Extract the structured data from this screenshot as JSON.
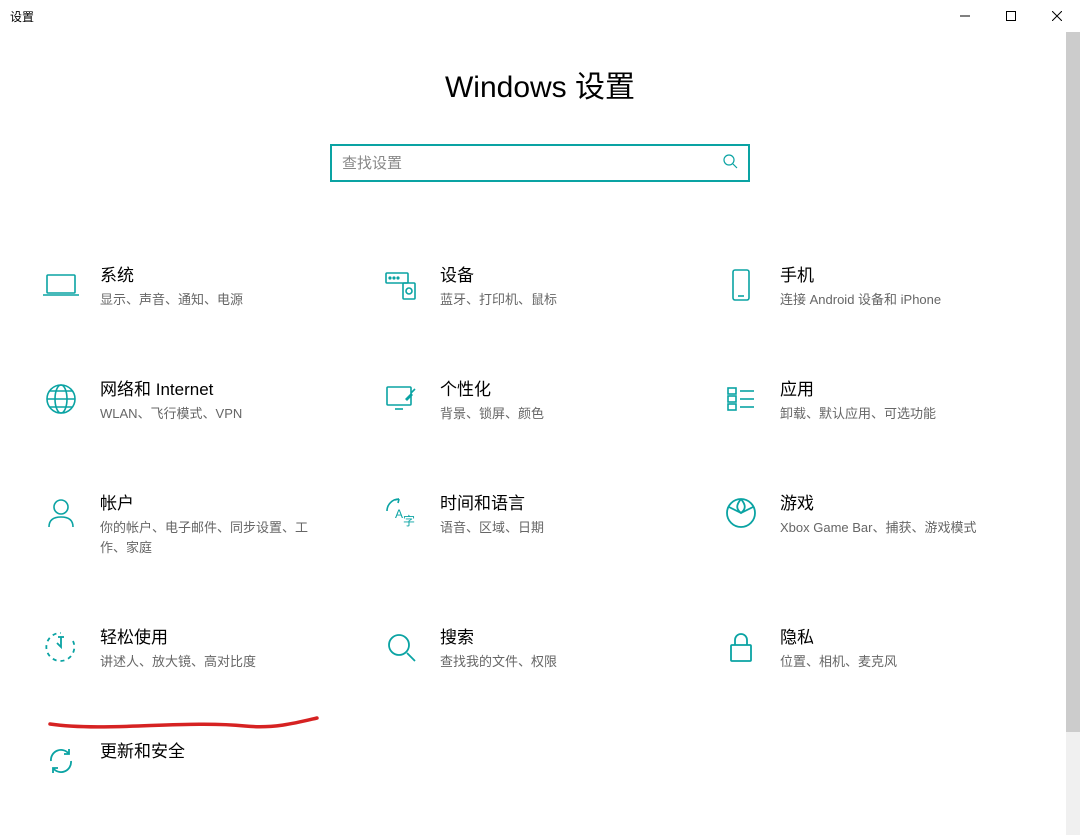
{
  "window": {
    "title": "设置"
  },
  "page": {
    "title": "Windows 设置"
  },
  "search": {
    "placeholder": "查找设置"
  },
  "tiles": [
    {
      "icon": "laptop",
      "title": "系统",
      "desc": "显示、声音、通知、电源"
    },
    {
      "icon": "devices",
      "title": "设备",
      "desc": "蓝牙、打印机、鼠标"
    },
    {
      "icon": "phone",
      "title": "手机",
      "desc": "连接 Android 设备和 iPhone"
    },
    {
      "icon": "globe",
      "title": "网络和 Internet",
      "desc": "WLAN、飞行模式、VPN"
    },
    {
      "icon": "personalize",
      "title": "个性化",
      "desc": "背景、锁屏、颜色"
    },
    {
      "icon": "apps",
      "title": "应用",
      "desc": "卸载、默认应用、可选功能"
    },
    {
      "icon": "account",
      "title": "帐户",
      "desc": "你的帐户、电子邮件、同步设置、工作、家庭"
    },
    {
      "icon": "time",
      "title": "时间和语言",
      "desc": "语音、区域、日期"
    },
    {
      "icon": "gaming",
      "title": "游戏",
      "desc": "Xbox Game Bar、捕获、游戏模式"
    },
    {
      "icon": "ease",
      "title": "轻松使用",
      "desc": "讲述人、放大镜、高对比度"
    },
    {
      "icon": "search",
      "title": "搜索",
      "desc": "查找我的文件、权限"
    },
    {
      "icon": "privacy",
      "title": "隐私",
      "desc": "位置、相机、麦克风"
    },
    {
      "icon": "update",
      "title": "更新和安全",
      "desc": ""
    }
  ],
  "colors": {
    "accent": "#0aa3a3"
  }
}
